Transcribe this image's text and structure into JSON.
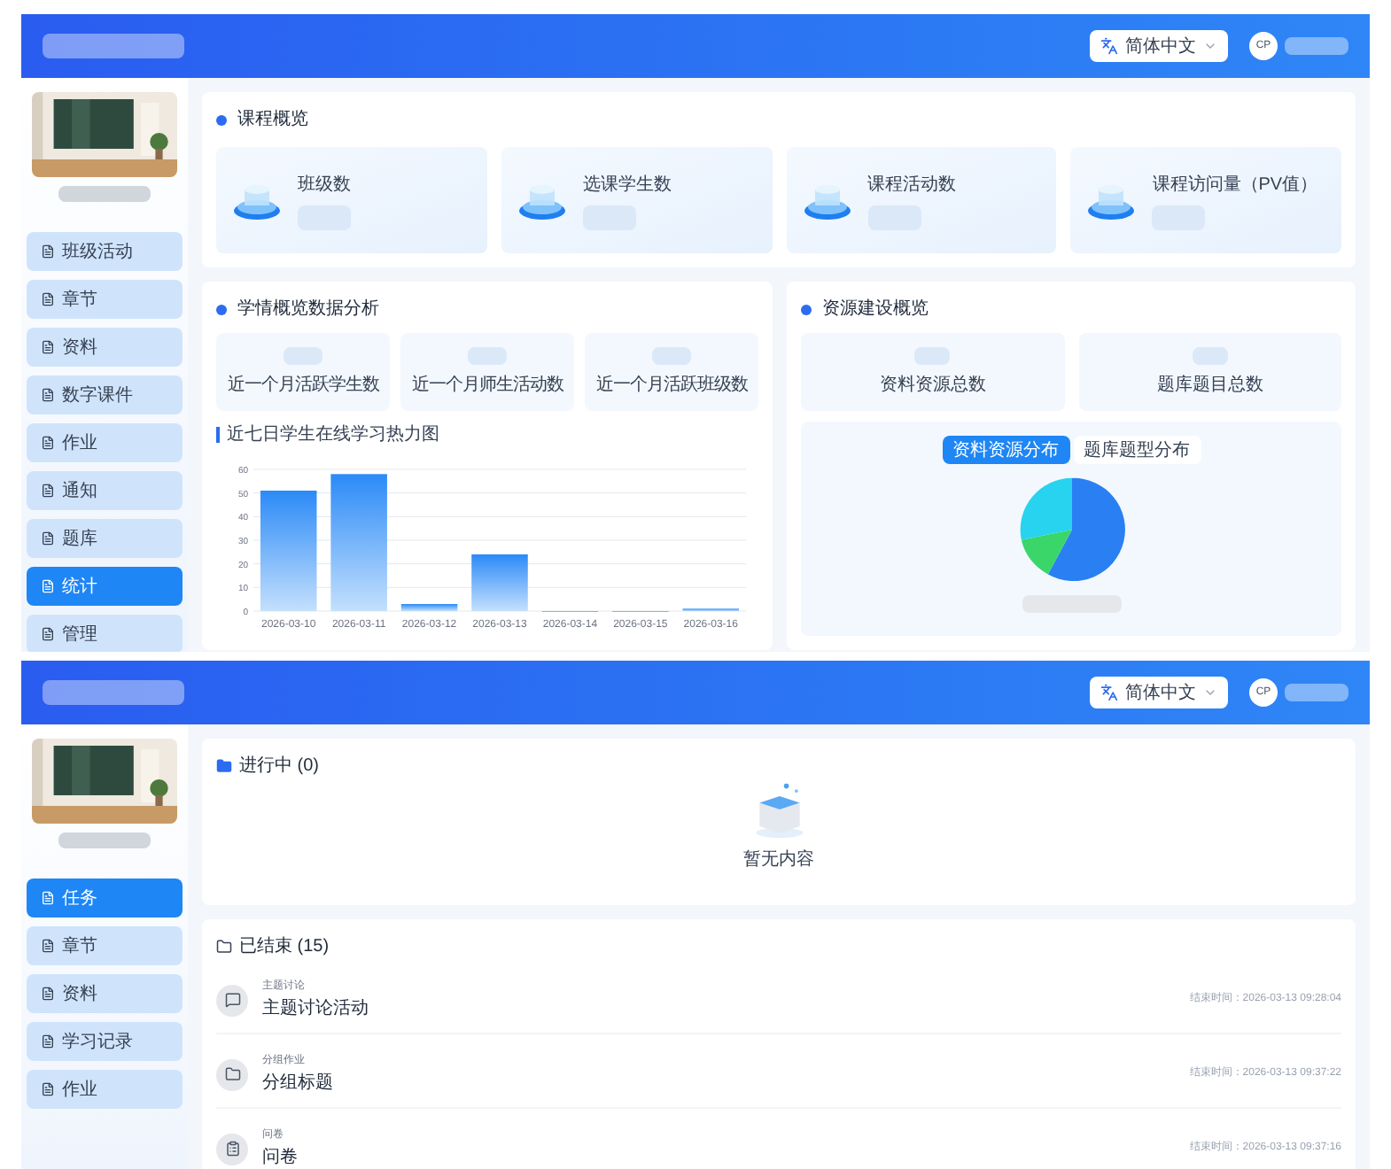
{
  "top": {
    "language": "简体中文",
    "avatar": "CP",
    "sidebar": [
      {
        "label": "班级活动",
        "selected": false
      },
      {
        "label": "章节",
        "selected": false
      },
      {
        "label": "资料",
        "selected": false
      },
      {
        "label": "数字课件",
        "selected": false
      },
      {
        "label": "作业",
        "selected": false
      },
      {
        "label": "通知",
        "selected": false
      },
      {
        "label": "题库",
        "selected": false
      },
      {
        "label": "统计",
        "selected": true
      },
      {
        "label": "管理",
        "selected": false
      }
    ],
    "overview": {
      "title": "课程概览",
      "stats": [
        {
          "label": "班级数"
        },
        {
          "label": "选课学生数"
        },
        {
          "label": "课程活动数"
        },
        {
          "label": "课程访问量（PV值）"
        }
      ]
    },
    "learning": {
      "title": "学情概览数据分析",
      "stats": [
        {
          "label": "近一个月活跃学生数"
        },
        {
          "label": "近一个月师生活动数"
        },
        {
          "label": "近一个月活跃班级数"
        }
      ],
      "chart": {
        "title": "近七日学生在线学习热力图",
        "chart_data": {
          "type": "bar",
          "categories": [
            "2026-03-10",
            "2026-03-11",
            "2026-03-12",
            "2026-03-13",
            "2026-03-14",
            "2026-03-15",
            "2026-03-16"
          ],
          "series": [
            {
              "color": "#2b8af7",
              "values": [
                51,
                58,
                3,
                24,
                0,
                0,
                1
              ]
            }
          ],
          "ylim": [
            0,
            60
          ],
          "yticks": [
            0,
            10,
            20,
            30,
            40,
            50,
            60
          ],
          "grid": true
        }
      }
    },
    "resources": {
      "title": "资源建设概览",
      "stats": [
        {
          "label": "资料资源总数"
        },
        {
          "label": "题库题目总数"
        }
      ],
      "tabs": [
        {
          "label": "资料资源分布",
          "selected": true
        },
        {
          "label": "题库题型分布",
          "selected": false
        }
      ]
    }
  },
  "bottom": {
    "language": "简体中文",
    "avatar": "CP",
    "sidebar": [
      {
        "label": "任务",
        "selected": true
      },
      {
        "label": "章节",
        "selected": false
      },
      {
        "label": "资料",
        "selected": false
      },
      {
        "label": "学习记录",
        "selected": false
      },
      {
        "label": "作业",
        "selected": false
      }
    ],
    "ongoing": {
      "title": "进行中 (0)",
      "empty": "暂无内容"
    },
    "finished": {
      "title": "已结束 (15)",
      "items": [
        {
          "type": "主题讨论",
          "title": "主题讨论活动",
          "time": "结束时间：2026-03-13 09:28:04"
        },
        {
          "type": "分组作业",
          "title": "分组标题",
          "time": "结束时间：2026-03-13 09:37:22"
        },
        {
          "type": "问卷",
          "title": "问卷",
          "time": "结束时间：2026-03-13 09:37:16"
        }
      ]
    }
  }
}
